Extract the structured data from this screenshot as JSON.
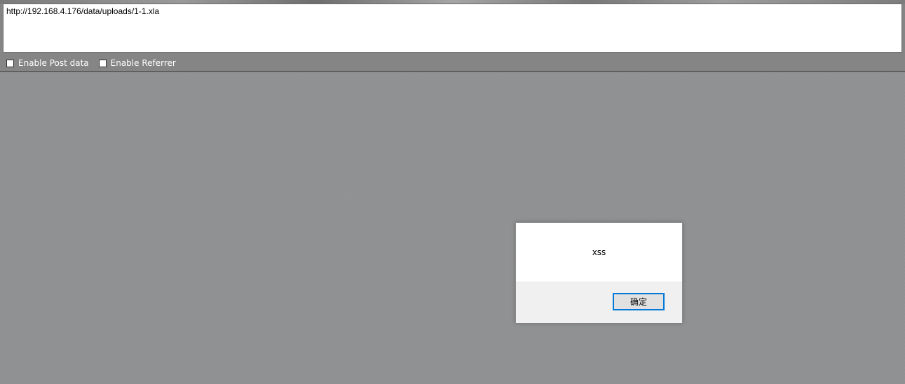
{
  "url_bar": {
    "value": "http://192.168.4.176/data/uploads/1-1.xla"
  },
  "options": [
    {
      "label": "Enable Post data",
      "checked": false
    },
    {
      "label": "Enable Referrer",
      "checked": false
    }
  ],
  "alert": {
    "message": "xss",
    "ok_label": "确定"
  },
  "colors": {
    "accent": "#0078d7",
    "page_background": "#909192",
    "toolbar_background": "#858585"
  }
}
